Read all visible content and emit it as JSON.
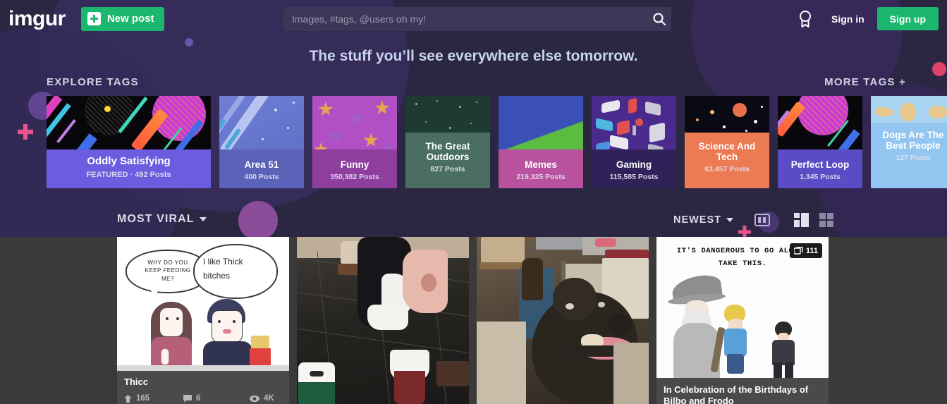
{
  "header": {
    "logo": "imgur",
    "new_post_label": "New post",
    "new_post_icon": "plus-square-icon",
    "search_placeholder": "Images, #tags, @users oh my!",
    "search_value": "",
    "search_icon": "search-icon",
    "badge_icon": "award-ribbon-icon",
    "sign_in_label": "Sign in",
    "sign_up_label": "Sign up",
    "accent_green": "#1bb76e",
    "bar_background": "#2b2742"
  },
  "hero": {
    "tagline": "The stuff you’ll see everywhere else tomorrow."
  },
  "explore": {
    "label": "EXPLORE TAGS",
    "more_label": "MORE TAGS +",
    "tags": [
      {
        "name": "Oddly Satisfying",
        "meta": "FEATURED · 492 Posts",
        "featured": true,
        "overlay": "#6c5ce0"
      },
      {
        "name": "Area 51",
        "meta": "400 Posts",
        "featured": false,
        "overlay": "#5a63b8"
      },
      {
        "name": "Funny",
        "meta": "350,382 Posts",
        "featured": false,
        "overlay": "#8e3f9e"
      },
      {
        "name": "The Great Outdoors",
        "meta": "827 Posts",
        "featured": false,
        "overlay": "#4a6e62"
      },
      {
        "name": "Memes",
        "meta": "219,325 Posts",
        "featured": false,
        "overlay": "#b8529e"
      },
      {
        "name": "Gaming",
        "meta": "115,585 Posts",
        "featured": false,
        "overlay": "#2e2259"
      },
      {
        "name": "Science And Tech",
        "meta": "63,457 Posts",
        "featured": false,
        "overlay": "#ec7a52"
      },
      {
        "name": "Perfect Loop",
        "meta": "1,345 Posts",
        "featured": false,
        "overlay": "#5b4bc4"
      },
      {
        "name": "Dogs Are The Best People",
        "meta": "127 Posts",
        "featured": false,
        "overlay": "#92c6f0"
      }
    ]
  },
  "sort": {
    "primary_label": "MOST VIRAL",
    "primary_caret": "chevron-down-icon",
    "secondary_label": "NEWEST",
    "secondary_caret": "chevron-down-icon",
    "media_icon": "filmstrip-icon",
    "grid_icon": "grid-mixed-icon",
    "grid_alt_icon": "grid-square-icon"
  },
  "posts": [
    {
      "title": "Thicc",
      "points": "165",
      "comments": "6",
      "views": "4K",
      "has_stats": true,
      "comic": {
        "bubble_left_line1": "WHY DO YOU",
        "bubble_left_line2": "KEEP FEEDING",
        "bubble_left_line3": "ME?",
        "bubble_right_line1": "I like Thick",
        "bubble_right_line2": "bitches"
      }
    },
    {
      "title": "",
      "points": "",
      "comments": "",
      "views": "",
      "has_stats": false
    },
    {
      "title": "",
      "points": "",
      "comments": "",
      "views": "",
      "has_stats": false
    },
    {
      "title": "In Celebration of the Birthdays of Bilbo and Frodo",
      "points": "",
      "comments": "",
      "views": "",
      "has_stats": false,
      "badge_count": "111",
      "badge_icon": "images-stack-icon",
      "meme_line1": "IT'S DANGEROUS TO GO ALONE,",
      "meme_line2": "TAKE THIS."
    }
  ]
}
